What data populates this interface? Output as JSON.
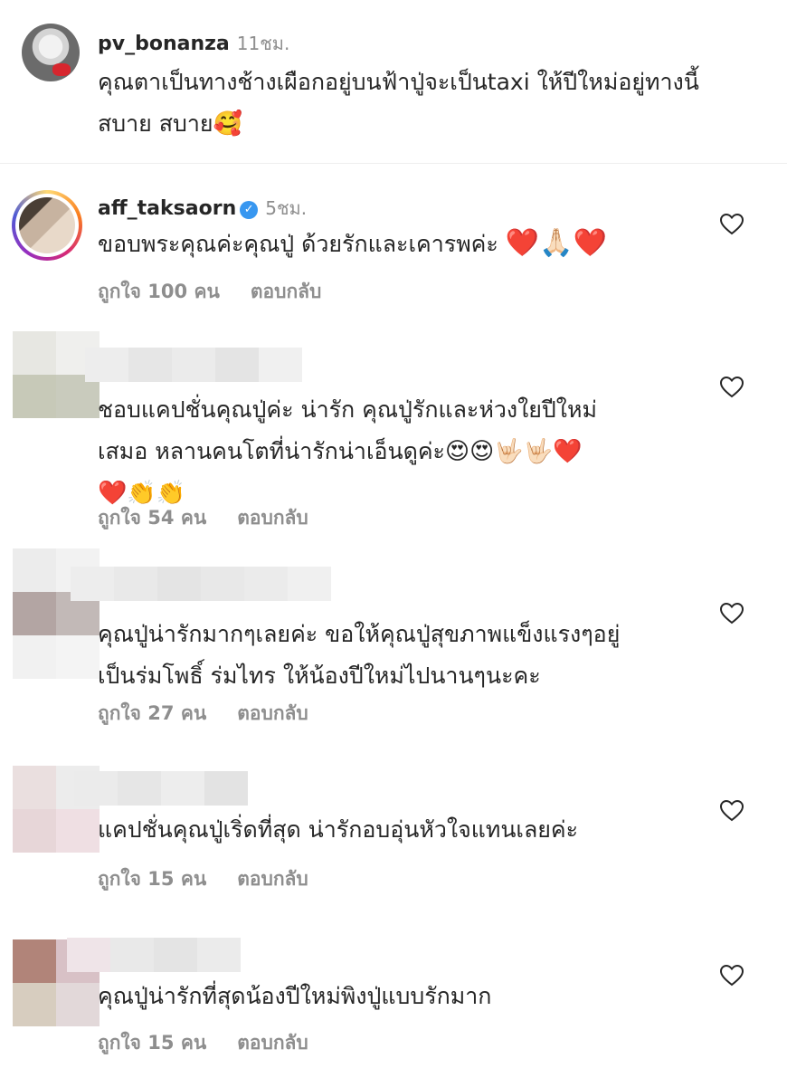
{
  "caption": {
    "username": "pv_bonanza",
    "time": "11ชม.",
    "text_line1": "คุณตาเป็นทางช้างเผือกอยู่บนฟ้าปู่จะเป็นtaxi ให้ปีใหม่อยู่ทางนี้",
    "text_line2": "สบาย สบาย",
    "emoji": "🥰"
  },
  "comments": [
    {
      "username": "aff_taksaorn",
      "verified": true,
      "time": "5ชม.",
      "text_line1": "ขอบพระคุณค่ะคุณปู่ ด้วยรักและเคารพค่ะ",
      "emojis": "❤️🙏🏻❤️",
      "likes": "ถูกใจ 100 คน",
      "reply": "ตอบกลับ"
    },
    {
      "username": "",
      "text_line1": "ชอบแคปชั่นคุณปู่ค่ะ น่ารัก คุณปู่รักและห่วงใยปีใหม่",
      "text_line2": "เสมอ หลานคนโตที่น่ารักน่าเอ็นดูค่ะ",
      "emojis_line2": "😍😍🤟🏻🤟🏻❤️",
      "emojis_line3": "❤️👏👏",
      "likes": "ถูกใจ 54 คน",
      "reply": "ตอบกลับ"
    },
    {
      "username": "",
      "text_line1": "คุณปู่น่ารักมากๆเลยค่ะ ขอให้คุณปู่สุขภาพแข็งแรงๆอยู่",
      "text_line2": "เป็นร่มโพธิ์ ร่มไทร ให้น้องปีใหม่ไปนานๆนะคะ",
      "likes": "ถูกใจ 27 คน",
      "reply": "ตอบกลับ"
    },
    {
      "username": "",
      "text_line1": "แคปชั่นคุณปู่เริ่ดที่สุด น่ารักอบอุ่นหัวใจแทนเลยค่ะ",
      "likes": "ถูกใจ 15 คน",
      "reply": "ตอบกลับ"
    },
    {
      "username": "",
      "text_line1": "คุณปู่น่ารักที่สุดน้องปีใหม่พิงปู่แบบรักมาก",
      "likes": "ถูกใจ 15 คน",
      "reply": "ตอบกลับ"
    }
  ],
  "icons": {
    "like": "heart-outline-icon",
    "verified": "verified-badge-icon"
  },
  "colors": {
    "muted": "#8e8e8e",
    "verified": "#3897f0",
    "heart_emoji": "#e0202e"
  }
}
